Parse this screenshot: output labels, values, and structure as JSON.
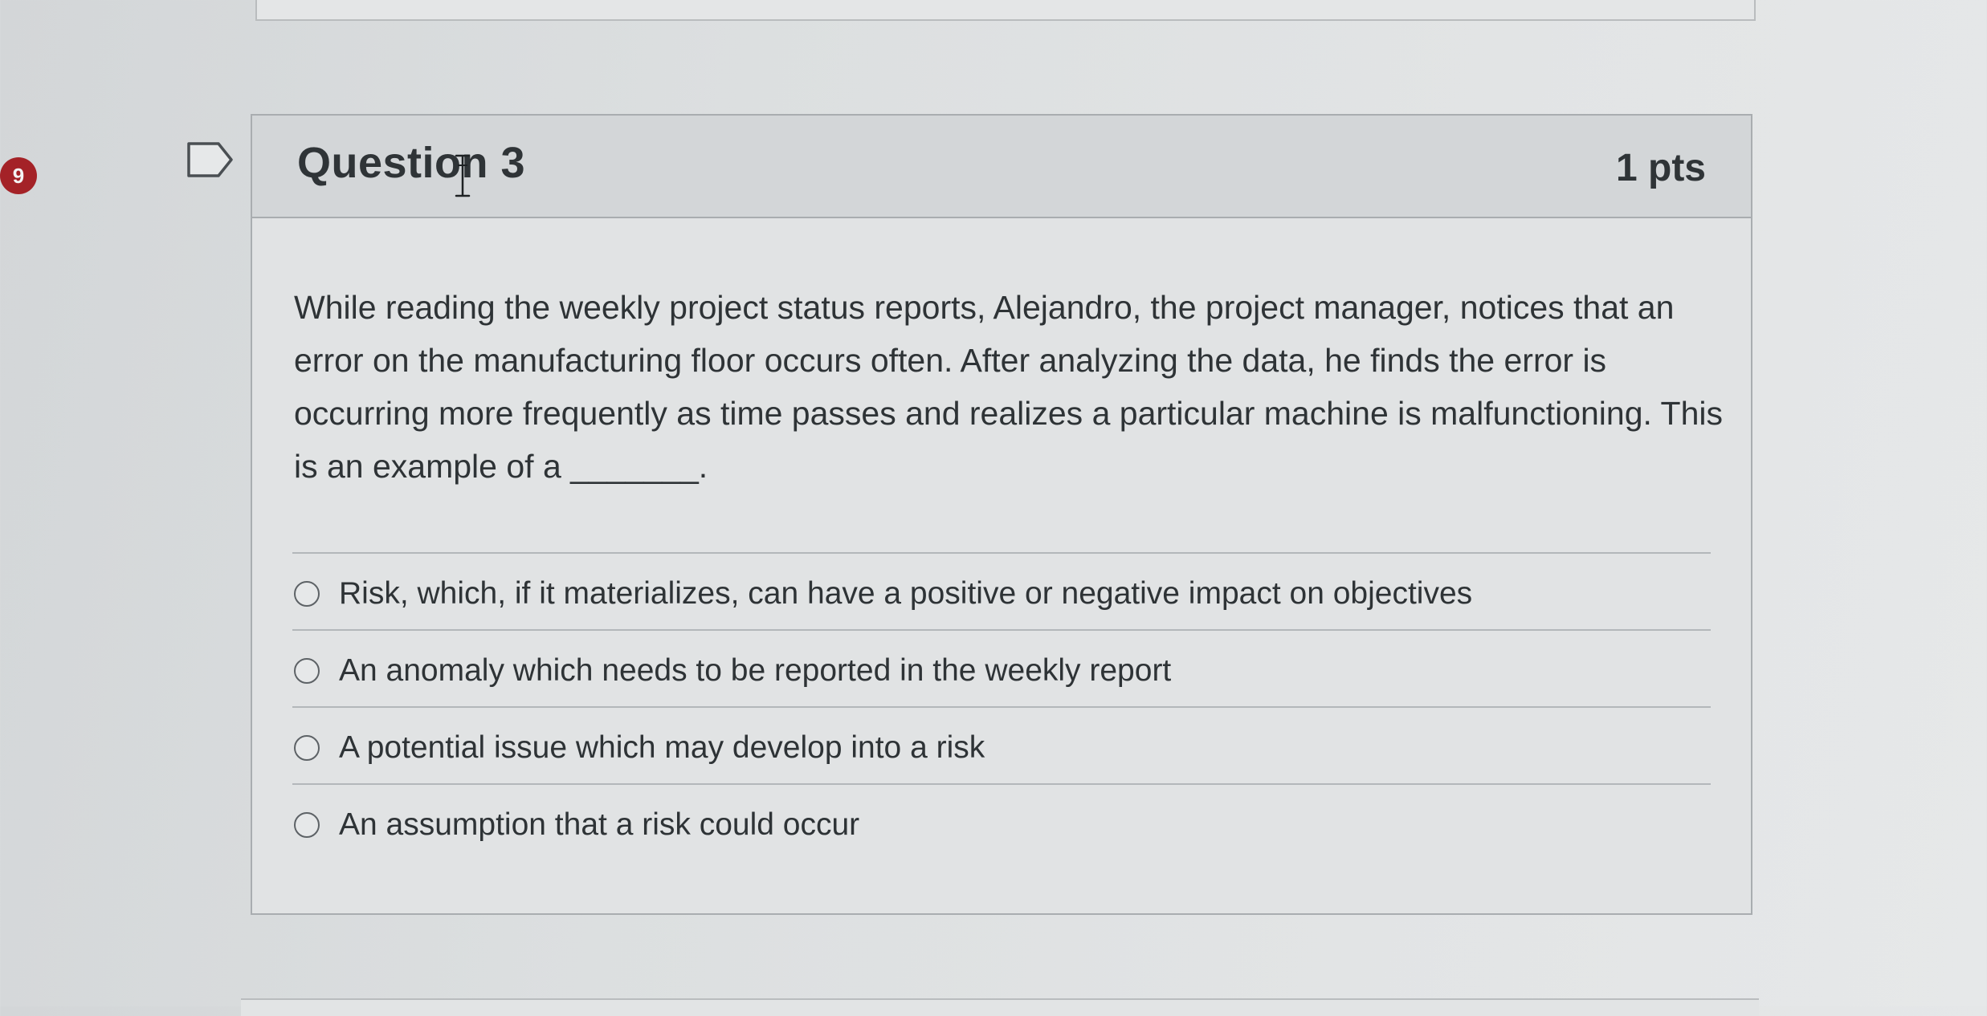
{
  "quiz": {
    "badge_count": "9",
    "question": {
      "title": "Question 3",
      "points": "1 pts",
      "text": "While reading the weekly project status reports, Alejandro, the project manager, notices that an error on the manufacturing floor occurs often. After analyzing the data, he finds the error is occurring more frequently as time passes and realizes a particular machine is malfunctioning. This is an example of a _______.",
      "answers": [
        "Risk, which, if it materializes, can have a positive or negative impact on objectives",
        "An anomaly which needs to be reported in the weekly report",
        "A potential issue which may develop into a risk",
        "An assumption that a risk could occur"
      ]
    }
  },
  "colors": {
    "badge": "#a42227",
    "card_header": "#d3d6d8",
    "border": "#a9adb0",
    "text": "#2e3336"
  },
  "icons": {
    "badge": "notification-count-badge",
    "flag": "flag-question-icon",
    "cursor": "text-cursor-icon",
    "radio": "radio-unselected-icon"
  }
}
